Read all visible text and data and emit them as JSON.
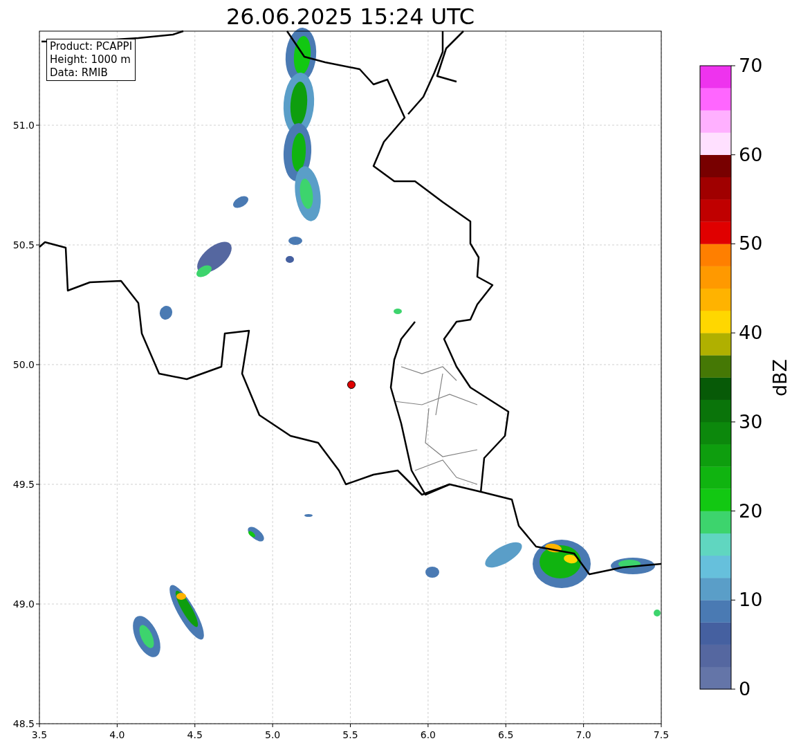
{
  "title": "26.06.2025 15:24 UTC",
  "info_box": [
    "Product: PCAPPI",
    "Height: 1000 m",
    "Data: RMIB"
  ],
  "map": {
    "x_ticks": [
      "3.5",
      "4.0",
      "4.5",
      "5.0",
      "5.5",
      "6.0",
      "6.5",
      "7.0",
      "7.5"
    ],
    "y_ticks": [
      "51.0",
      "50.5",
      "50.0",
      "49.5",
      "49.0",
      "48.5"
    ]
  },
  "colorbar": {
    "label": "dBZ",
    "ticks": [
      "70",
      "60",
      "50",
      "40",
      "30",
      "20",
      "10",
      "0"
    ],
    "segments": [
      {
        "color": "#6475a8"
      },
      {
        "color": "#5567a0"
      },
      {
        "color": "#4560a0"
      },
      {
        "color": "#4a7ab3"
      },
      {
        "color": "#5a9ec8"
      },
      {
        "color": "#66c0dc"
      },
      {
        "color": "#60d6c0"
      },
      {
        "color": "#3dd46d"
      },
      {
        "color": "#12c812"
      },
      {
        "color": "#10b410"
      },
      {
        "color": "#0e9e0e"
      },
      {
        "color": "#0c880c"
      },
      {
        "color": "#0a740a"
      },
      {
        "color": "#075a07"
      },
      {
        "color": "#457805"
      },
      {
        "color": "#b0b000"
      },
      {
        "color": "#ffd700"
      },
      {
        "color": "#ffb300"
      },
      {
        "color": "#ff9900"
      },
      {
        "color": "#ff7f00"
      },
      {
        "color": "#e00000"
      },
      {
        "color": "#c00000"
      },
      {
        "color": "#a00000"
      },
      {
        "color": "#780000"
      },
      {
        "color": "#ffe0ff"
      },
      {
        "color": "#ffb0ff"
      },
      {
        "color": "#ff66ff"
      },
      {
        "color": "#ee33ee"
      }
    ]
  }
}
